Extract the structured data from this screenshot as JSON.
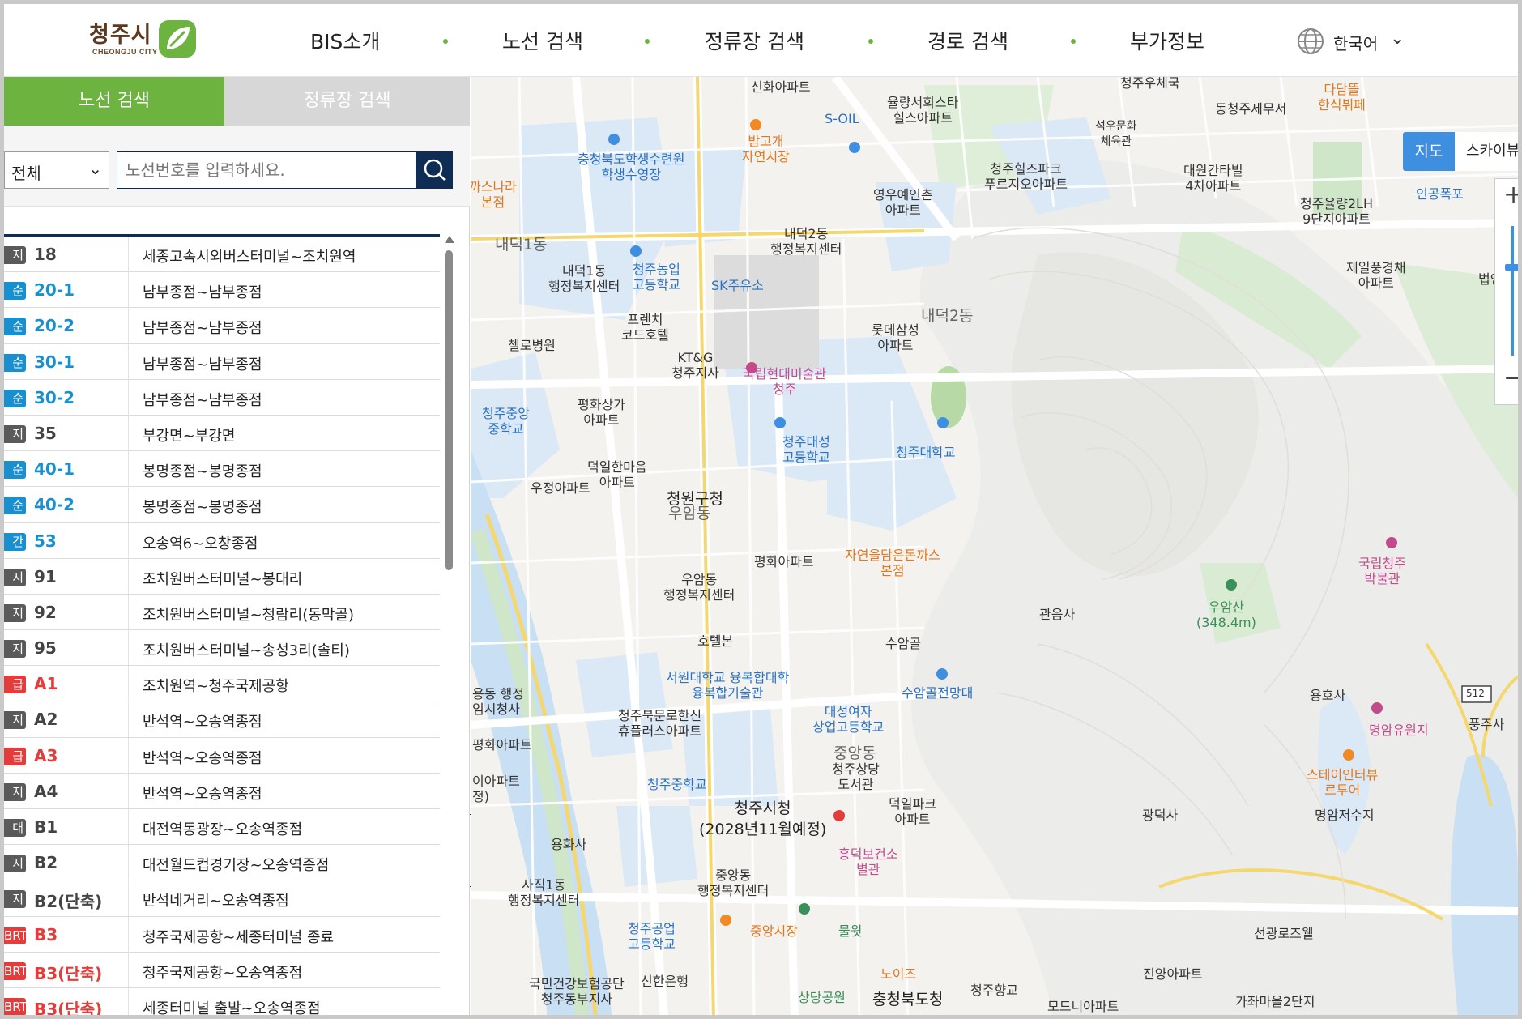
{
  "header": {
    "logo_text": "청주시",
    "logo_sub": "CHEONGJU CITY",
    "nav": [
      "BIS소개",
      "노선 검색",
      "정류장 검색",
      "경로 검색",
      "부가정보"
    ],
    "language": "한국어"
  },
  "panel": {
    "tabs": {
      "route": "노선 검색",
      "stop": "정류장 검색"
    },
    "select_value": "전체",
    "search_placeholder": "노선번호를 입력하세요.",
    "routes": [
      {
        "badge": "지종",
        "badge_color": "#5a5a5a",
        "number": "18",
        "desc": "세종고속시외버스터미널~조치원역"
      },
      {
        "badge": "순환",
        "badge_color": "#1a8fcf",
        "number": "20-1",
        "desc": "남부종점~남부종점"
      },
      {
        "badge": "순환",
        "badge_color": "#1a8fcf",
        "number": "20-2",
        "desc": "남부종점~남부종점"
      },
      {
        "badge": "순환",
        "badge_color": "#1a8fcf",
        "number": "30-1",
        "desc": "남부종점~남부종점"
      },
      {
        "badge": "순환",
        "badge_color": "#1a8fcf",
        "number": "30-2",
        "desc": "남부종점~남부종점"
      },
      {
        "badge": "지종",
        "badge_color": "#5a5a5a",
        "number": "35",
        "desc": "부강면~부강면"
      },
      {
        "badge": "순환",
        "badge_color": "#1a8fcf",
        "number": "40-1",
        "desc": "봉명종점~봉명종점"
      },
      {
        "badge": "순환",
        "badge_color": "#1a8fcf",
        "number": "40-2",
        "desc": "봉명종점~봉명종점"
      },
      {
        "badge": "간선",
        "badge_color": "#1a8fcf",
        "number": "53",
        "desc": "오송역6~오창종점"
      },
      {
        "badge": "지종",
        "badge_color": "#5a5a5a",
        "number": "91",
        "desc": "조치원버스터미널~봉대리"
      },
      {
        "badge": "지종",
        "badge_color": "#5a5a5a",
        "number": "92",
        "desc": "조치원버스터미널~청람리(동막골)"
      },
      {
        "badge": "지종",
        "badge_color": "#5a5a5a",
        "number": "95",
        "desc": "조치원버스터미널~송성3리(솔티)"
      },
      {
        "badge": "급행",
        "badge_color": "#e43b3b",
        "number": "A1",
        "desc": "조치원역~청주국제공항"
      },
      {
        "badge": "지종",
        "badge_color": "#5a5a5a",
        "number": "A2",
        "desc": "반석역~오송역종점"
      },
      {
        "badge": "급행",
        "badge_color": "#e43b3b",
        "number": "A3",
        "desc": "반석역~오송역종점"
      },
      {
        "badge": "지종",
        "badge_color": "#5a5a5a",
        "number": "A4",
        "desc": "반석역~오송역종점"
      },
      {
        "badge": "대전",
        "badge_color": "#5a5a5a",
        "number": "B1",
        "desc": "대전역동광장~오송역종점"
      },
      {
        "badge": "지종",
        "badge_color": "#5a5a5a",
        "number": "B2",
        "desc": "대전월드컵경기장~오송역종점"
      },
      {
        "badge": "지종",
        "badge_color": "#5a5a5a",
        "number": "B2(단축)",
        "desc": "반석네거리~오송역종점"
      },
      {
        "badge": "BRT",
        "badge_color": "#e43b3b",
        "number": "B3",
        "desc": "청주국제공항~세종터미널 종료"
      },
      {
        "badge": "BRT",
        "badge_color": "#e43b3b",
        "number": "B3(단축)",
        "desc": "청주국제공항~오송역종점"
      },
      {
        "badge": "BRT",
        "badge_color": "#e43b3b",
        "number": "B3(단축)",
        "desc": "세종터미널 출발~오송역종점"
      }
    ]
  },
  "map": {
    "toggle": {
      "map": "지도",
      "sky": "스카이뷰"
    },
    "labels": [
      {
        "text": "신화아파트",
        "cls": ""
      },
      {
        "text": "S-OIL",
        "cls": "lbl-b"
      },
      {
        "text": "율량서희스타\n힐스아파트",
        "cls": ""
      },
      {
        "text": "청주우체국",
        "cls": ""
      },
      {
        "text": "동청주세무서",
        "cls": ""
      },
      {
        "text": "다담뜰\n한식뷔페",
        "cls": "lbl-o"
      },
      {
        "text": "석우문화\n체육관",
        "cls": ""
      },
      {
        "text": "대원칸타빌\n4차아파트",
        "cls": ""
      },
      {
        "text": "청주율량2LH\n9단지아파트",
        "cls": ""
      },
      {
        "text": "인공폭포",
        "cls": "lbl-b"
      },
      {
        "text": "밤고개\n자연시장",
        "cls": "lbl-o"
      },
      {
        "text": "충청북도학생수련원\n학생수영장",
        "cls": "lbl-b"
      },
      {
        "text": "청주힐즈파크\n푸르지오아파트",
        "cls": ""
      },
      {
        "text": "영우예인촌\n아파트",
        "cls": ""
      },
      {
        "text": "까스나라\n본점",
        "cls": "lbl-o"
      },
      {
        "text": "내덕1동",
        "cls": "lbl-big"
      },
      {
        "text": "내덕2동\n행정복지센터",
        "cls": ""
      },
      {
        "text": "내덕1동\n행정복지센터",
        "cls": ""
      },
      {
        "text": "청주농업\n고등학교",
        "cls": "lbl-b"
      },
      {
        "text": "SK주유소",
        "cls": "lbl-b"
      },
      {
        "text": "제일풍경채\n아파트",
        "cls": ""
      },
      {
        "text": "프렌치\n코드호텔",
        "cls": ""
      },
      {
        "text": "롯데삼성\n아파트",
        "cls": ""
      },
      {
        "text": "내덕2동",
        "cls": "lbl-big"
      },
      {
        "text": "첼로병원",
        "cls": ""
      },
      {
        "text": "KT&G\n청주지사",
        "cls": ""
      },
      {
        "text": "국립현대미술관\n청주",
        "cls": "lbl-p"
      },
      {
        "text": "청주중앙\n중학교",
        "cls": "lbl-b"
      },
      {
        "text": "평화상가\n아파트",
        "cls": ""
      },
      {
        "text": "청주대성\n고등학교",
        "cls": "lbl-b"
      },
      {
        "text": "청주대학교",
        "cls": "lbl-b"
      },
      {
        "text": "우정아파트",
        "cls": ""
      },
      {
        "text": "덕일한마음\n아파트",
        "cls": ""
      },
      {
        "text": "청원구청",
        "cls": "lbl-big"
      },
      {
        "text": "우암동",
        "cls": "lbl-big"
      },
      {
        "text": "평화아파트",
        "cls": ""
      },
      {
        "text": "자연을담은돈까스\n본점",
        "cls": "lbl-o"
      },
      {
        "text": "국립청주\n박물관",
        "cls": "lbl-p"
      },
      {
        "text": "우암동\n행정복지센터",
        "cls": ""
      },
      {
        "text": "관음사",
        "cls": ""
      },
      {
        "text": "우암산\n(348.4m)",
        "cls": "lbl-g"
      },
      {
        "text": "호텔본",
        "cls": ""
      },
      {
        "text": "수암골",
        "cls": ""
      },
      {
        "text": "서원대학교 융복합대학\n융복합기술관",
        "cls": "lbl-b"
      },
      {
        "text": "수암골전망대",
        "cls": "lbl-b"
      },
      {
        "text": "용호사",
        "cls": ""
      },
      {
        "text": "대성여자\n상업고등학교",
        "cls": "lbl-b"
      },
      {
        "text": "청주북문로한신\n휴플러스아파트",
        "cls": ""
      },
      {
        "text": "명암유원지",
        "cls": "lbl-p"
      },
      {
        "text": "풍주사",
        "cls": ""
      },
      {
        "text": "중앙동",
        "cls": "lbl-big"
      },
      {
        "text": "청주상당\n도서관",
        "cls": ""
      },
      {
        "text": "청주중학교",
        "cls": "lbl-b"
      },
      {
        "text": "덕일파크\n아파트",
        "cls": ""
      },
      {
        "text": "스테이인터뷰\n르투어",
        "cls": "lbl-o"
      },
      {
        "text": "광덕사",
        "cls": ""
      },
      {
        "text": "명암저수지",
        "cls": ""
      },
      {
        "text": "청주시청\n(2028년11월예정)",
        "cls": "lbl-big"
      },
      {
        "text": "용화사",
        "cls": ""
      },
      {
        "text": "흥덕보건소\n별관",
        "cls": "lbl-p"
      },
      {
        "text": "사직1동\n행정복지센터",
        "cls": ""
      },
      {
        "text": "중앙동\n행정복지센터",
        "cls": ""
      },
      {
        "text": "청주공업\n고등학교",
        "cls": "lbl-b"
      },
      {
        "text": "중앙시장",
        "cls": "lbl-o"
      },
      {
        "text": "물윗",
        "cls": "lbl-g"
      },
      {
        "text": "선광로즈웰",
        "cls": ""
      },
      {
        "text": "국민건강보험공단\n청주동부지사",
        "cls": ""
      },
      {
        "text": "신한은행",
        "cls": ""
      },
      {
        "text": "상당공원",
        "cls": "lbl-g"
      },
      {
        "text": "노이즈",
        "cls": "lbl-o"
      },
      {
        "text": "충청북도청",
        "cls": "lbl-big"
      },
      {
        "text": "청주향교",
        "cls": ""
      },
      {
        "text": "모드니아파트",
        "cls": ""
      },
      {
        "text": "진양아파트",
        "cls": ""
      },
      {
        "text": "가좌마을2단지",
        "cls": ""
      },
      {
        "text": "법인",
        "cls": ""
      },
      {
        "text": "용동 행정\n임시청사",
        "cls": ""
      },
      {
        "text": "평화아파트",
        "cls": ""
      },
      {
        "text": "이아파트\n정)",
        "cls": ""
      },
      {
        "text": "512",
        "cls": ""
      }
    ]
  }
}
